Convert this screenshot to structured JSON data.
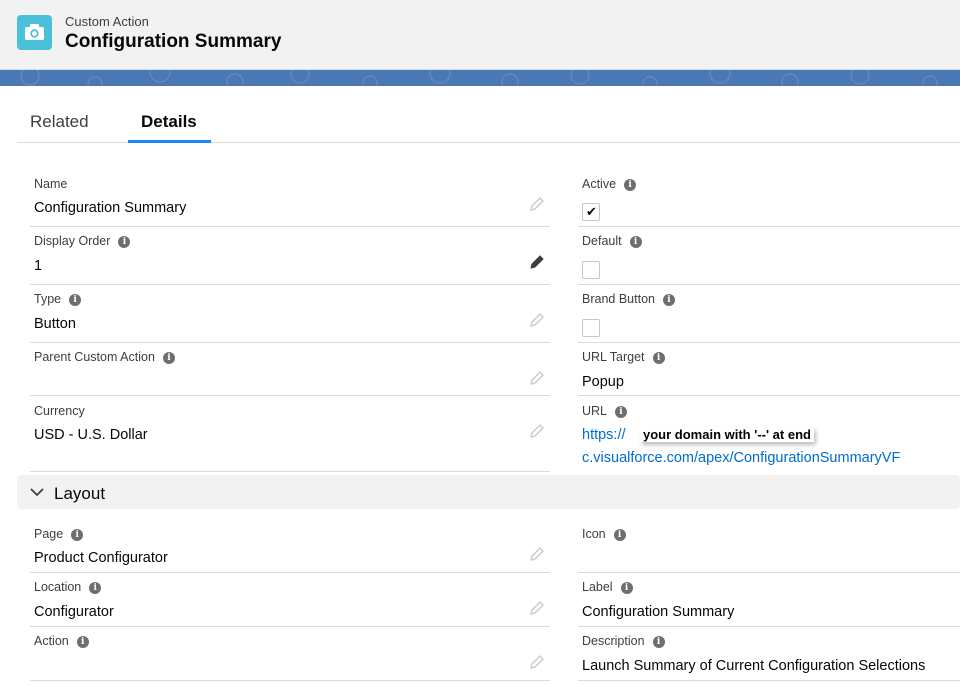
{
  "header": {
    "object_type": "Custom Action",
    "title": "Configuration Summary"
  },
  "tabs": {
    "related": "Related",
    "details": "Details"
  },
  "fields": {
    "name": {
      "label": "Name",
      "value": "Configuration Summary"
    },
    "display_order": {
      "label": "Display Order",
      "value": "1"
    },
    "type": {
      "label": "Type",
      "value": "Button"
    },
    "parent_custom_action": {
      "label": "Parent Custom Action",
      "value": ""
    },
    "currency": {
      "label": "Currency",
      "value": "USD - U.S. Dollar"
    },
    "active": {
      "label": "Active",
      "checked": true
    },
    "default": {
      "label": "Default",
      "checked": false
    },
    "brand_button": {
      "label": "Brand Button",
      "checked": false
    },
    "url_target": {
      "label": "URL Target",
      "value": "Popup"
    },
    "url": {
      "label": "URL",
      "line1": "https://",
      "line2": "c.visualforce.com/apex/ConfigurationSummaryVF",
      "annotation": "your domain with '--' at end"
    }
  },
  "layout_section": {
    "title": "Layout",
    "fields": {
      "page": {
        "label": "Page",
        "value": "Product Configurator"
      },
      "location": {
        "label": "Location",
        "value": "Configurator"
      },
      "action": {
        "label": "Action",
        "value": ""
      },
      "icon": {
        "label": "Icon",
        "value": ""
      },
      "label": {
        "label": "Label",
        "value": "Configuration Summary"
      },
      "description": {
        "label": "Description",
        "value": "Launch Summary of Current Configuration Selections"
      }
    }
  },
  "colors": {
    "header_icon_bg": "#4bc0d9",
    "tab_active_underline": "#1589ee",
    "link": "#006dcc",
    "band": "#4a78b5"
  },
  "icons": {
    "header": "camera-icon",
    "info": "info-icon",
    "edit": "pencil-icon",
    "section": "chevron-down-icon"
  }
}
